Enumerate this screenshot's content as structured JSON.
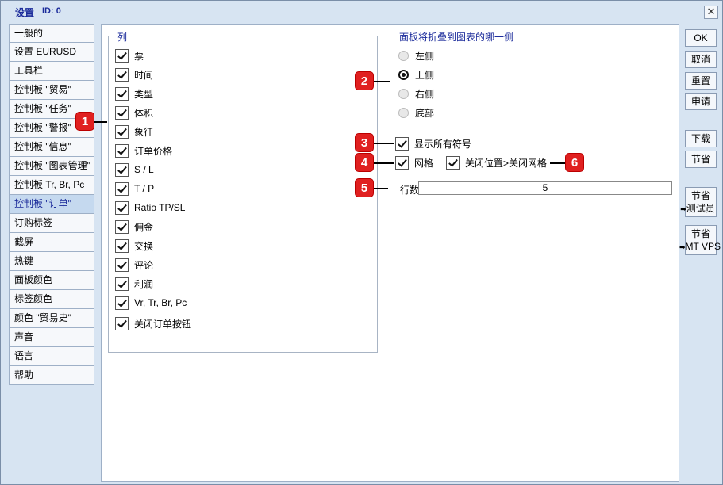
{
  "window": {
    "title": "设置",
    "id_label": "ID: 0",
    "close_glyph": "✕"
  },
  "sidebar": {
    "items": [
      {
        "label": "一般的"
      },
      {
        "label": "设置 EURUSD"
      },
      {
        "label": "工具栏"
      },
      {
        "label": "控制板 \"贸易\""
      },
      {
        "label": "控制板 \"任务\""
      },
      {
        "label": "控制板 \"警报\""
      },
      {
        "label": "控制板 \"信息\""
      },
      {
        "label": "控制板 \"图表管理\""
      },
      {
        "label": "控制板 Tr, Br, Pc"
      },
      {
        "label": "控制板 \"订单\""
      },
      {
        "label": "订购标签"
      },
      {
        "label": "截屏"
      },
      {
        "label": "热键"
      },
      {
        "label": "面板颜色"
      },
      {
        "label": "标签颜色"
      },
      {
        "label": "颜色 \"贸易史\""
      },
      {
        "label": "声音"
      },
      {
        "label": "语言"
      },
      {
        "label": "帮助"
      }
    ],
    "selected_index": 9
  },
  "columns": {
    "legend": "列",
    "items": [
      {
        "label": "票",
        "checked": true
      },
      {
        "label": "时间",
        "checked": true
      },
      {
        "label": "类型",
        "checked": true
      },
      {
        "label": "体积",
        "checked": true
      },
      {
        "label": "象征",
        "checked": true
      },
      {
        "label": "订单价格",
        "checked": true
      },
      {
        "label": "S / L",
        "checked": true
      },
      {
        "label": "T / P",
        "checked": true
      },
      {
        "label": "Ratio TP/SL",
        "checked": true
      },
      {
        "label": "佣金",
        "checked": true
      },
      {
        "label": "交换",
        "checked": true
      },
      {
        "label": "评论",
        "checked": true
      },
      {
        "label": "利润",
        "checked": true
      },
      {
        "label": "Vr, Tr, Br, Pc",
        "checked": true
      },
      {
        "label": "关闭订单按钮",
        "checked": true
      }
    ]
  },
  "fold_side": {
    "legend": "面板将折叠到图表的哪一侧",
    "options": [
      {
        "label": "左侧",
        "selected": false
      },
      {
        "label": "上侧",
        "selected": true
      },
      {
        "label": "右侧",
        "selected": false
      },
      {
        "label": "底部",
        "selected": false
      }
    ]
  },
  "options": {
    "show_all_symbols": {
      "label": "显示所有符号",
      "checked": true
    },
    "grid": {
      "label": "网格",
      "checked": true
    },
    "close_pos_grid": {
      "label": "关闭位置>关闭网格",
      "checked": true
    },
    "rows": {
      "label": "行数:",
      "value": "5"
    }
  },
  "buttons": {
    "ok": "OK",
    "cancel": "取消",
    "reset": "重置",
    "apply": "申请",
    "download": "下载",
    "save": "节省",
    "save_tester_top": "节省",
    "save_tester_bottom": "测试员",
    "save_vps_top": "节省",
    "save_vps_bottom": "MT VPS",
    "arrow_glyph": "➡"
  },
  "annotations": [
    "1",
    "2",
    "3",
    "4",
    "5",
    "6"
  ],
  "colors": {
    "badge": "#e02020",
    "accent_text": "#1a2a9a",
    "window_bg": "#d7e4f2"
  }
}
